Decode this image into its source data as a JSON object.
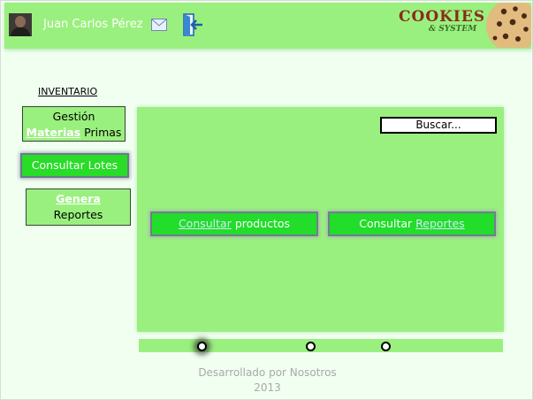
{
  "header": {
    "username": "Juan Carlos Pérez",
    "logo_line1": "COOKIES",
    "logo_line2": "& SYSTEM",
    "accent": "#9af07e"
  },
  "sidebar": {
    "title": "INVENTARIO",
    "items": [
      {
        "line1": "Gestión",
        "line2_link": "Materias",
        "line2_rest": " Primas"
      },
      {
        "label": "Consultar Lotes"
      },
      {
        "line1_link": "Genera",
        "line2": "Reportes"
      }
    ]
  },
  "main": {
    "search_label": "Buscar...",
    "buttons": [
      {
        "link": "Consultar",
        "rest": " productos"
      },
      {
        "prefix": "Consultar ",
        "link": "Reportes"
      }
    ]
  },
  "slider": {
    "active_index": 0,
    "count": 3
  },
  "footer": {
    "line1": "Desarrollado por Nosotros",
    "line2": "2013"
  },
  "colors": {
    "button_green": "#22dd2a",
    "background": "#f1fff1",
    "panel": "#9af07e"
  }
}
